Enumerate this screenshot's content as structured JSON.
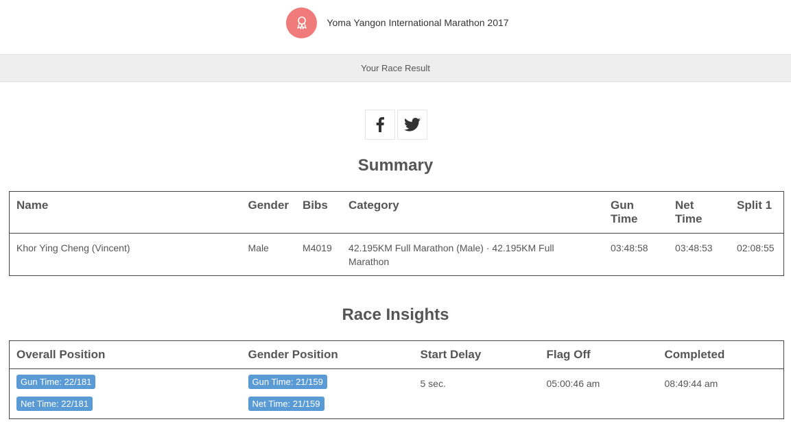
{
  "header": {
    "event_title": "Yoma Yangon International Marathon 2017",
    "logo_icon": "medal-ribbon-icon",
    "logo_color": "#f07b7b"
  },
  "subbar": {
    "label": "Your Race Result"
  },
  "share": {
    "facebook_icon": "facebook-icon",
    "twitter_icon": "twitter-icon"
  },
  "summary": {
    "title": "Summary",
    "headers": [
      "Name",
      "Gender",
      "Bibs",
      "Category",
      "Gun Time",
      "Net Time",
      "Split 1"
    ],
    "row": {
      "name": "Khor Ying Cheng (Vincent)",
      "gender": "Male",
      "bib": "M4019",
      "category": "42.195KM Full Marathon (Male) · 42.195KM Full Marathon",
      "gun_time": "03:48:58",
      "net_time": "03:48:53",
      "split_1": "02:08:55"
    }
  },
  "insights": {
    "title": "Race Insights",
    "headers": [
      "Overall Position",
      "Gender Position",
      "Start Delay",
      "Flag Off",
      "Completed"
    ],
    "overall_gun": "Gun Time: 22/181",
    "overall_net": "Net Time: 22/181",
    "gender_gun": "Gun Time: 21/159",
    "gender_net": "Net Time: 21/159",
    "start_delay": "5 sec.",
    "flag_off": "05:00:46 am",
    "completed": "08:49:44 am",
    "badge_color": "#5b9bd5"
  }
}
